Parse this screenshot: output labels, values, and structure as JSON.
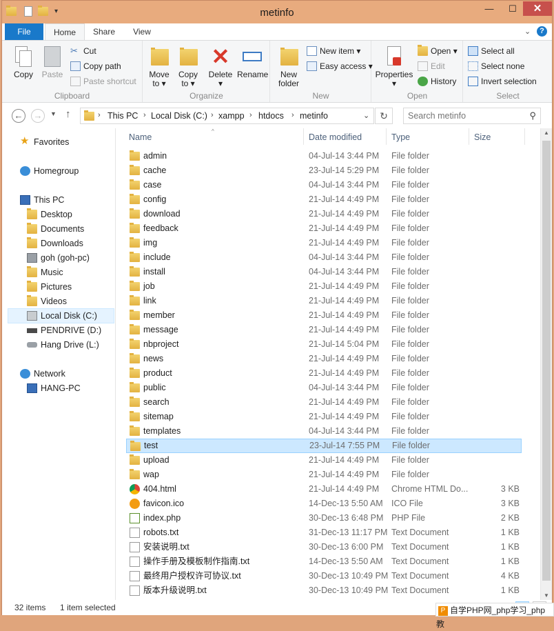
{
  "window": {
    "title": "metinfo",
    "minimize_icon": "minimize-icon",
    "maximize_icon": "maximize-icon",
    "close_label": "✕"
  },
  "tabs": [
    {
      "label": "File"
    },
    {
      "label": "Home"
    },
    {
      "label": "Share"
    },
    {
      "label": "View"
    }
  ],
  "ribbon": {
    "clipboard": {
      "label": "Clipboard",
      "copy": "Copy",
      "paste": "Paste",
      "cut": "Cut",
      "copy_path": "Copy path",
      "paste_shortcut": "Paste shortcut"
    },
    "organize": {
      "label": "Organize",
      "move_to": "Move to",
      "copy_to": "Copy to",
      "delete": "Delete",
      "rename": "Rename"
    },
    "new": {
      "label": "New",
      "new_folder": "New folder",
      "new_item": "New item",
      "easy_access": "Easy access"
    },
    "open": {
      "label": "Open",
      "properties": "Properties",
      "open": "Open",
      "edit": "Edit",
      "history": "History"
    },
    "select": {
      "label": "Select",
      "select_all": "Select all",
      "select_none": "Select none",
      "invert": "Invert selection"
    }
  },
  "address": {
    "crumbs": [
      "This PC",
      "Local Disk (C:)",
      "xampp",
      "htdocs",
      "metinfo"
    ],
    "search_placeholder": "Search metinfo"
  },
  "nav": {
    "favorites": "Favorites",
    "homegroup": "Homegroup",
    "this_pc": "This PC",
    "pc_items": [
      "Desktop",
      "Documents",
      "Downloads",
      "goh (goh-pc)",
      "Music",
      "Pictures",
      "Videos",
      "Local Disk (C:)",
      "PENDRIVE (D:)",
      "Hang Drive (L:)"
    ],
    "network": "Network",
    "network_items": [
      "HANG-PC"
    ]
  },
  "columns": {
    "name": "Name",
    "date": "Date modified",
    "type": "Type",
    "size": "Size"
  },
  "files": [
    {
      "name": "admin",
      "date": "04-Jul-14 3:44 PM",
      "type": "File folder",
      "size": "",
      "icon": "folder"
    },
    {
      "name": "cache",
      "date": "23-Jul-14 5:29 PM",
      "type": "File folder",
      "size": "",
      "icon": "folder"
    },
    {
      "name": "case",
      "date": "04-Jul-14 3:44 PM",
      "type": "File folder",
      "size": "",
      "icon": "folder"
    },
    {
      "name": "config",
      "date": "21-Jul-14 4:49 PM",
      "type": "File folder",
      "size": "",
      "icon": "folder"
    },
    {
      "name": "download",
      "date": "21-Jul-14 4:49 PM",
      "type": "File folder",
      "size": "",
      "icon": "folder"
    },
    {
      "name": "feedback",
      "date": "21-Jul-14 4:49 PM",
      "type": "File folder",
      "size": "",
      "icon": "folder"
    },
    {
      "name": "img",
      "date": "21-Jul-14 4:49 PM",
      "type": "File folder",
      "size": "",
      "icon": "folder"
    },
    {
      "name": "include",
      "date": "04-Jul-14 3:44 PM",
      "type": "File folder",
      "size": "",
      "icon": "folder"
    },
    {
      "name": "install",
      "date": "04-Jul-14 3:44 PM",
      "type": "File folder",
      "size": "",
      "icon": "folder"
    },
    {
      "name": "job",
      "date": "21-Jul-14 4:49 PM",
      "type": "File folder",
      "size": "",
      "icon": "folder"
    },
    {
      "name": "link",
      "date": "21-Jul-14 4:49 PM",
      "type": "File folder",
      "size": "",
      "icon": "folder"
    },
    {
      "name": "member",
      "date": "21-Jul-14 4:49 PM",
      "type": "File folder",
      "size": "",
      "icon": "folder"
    },
    {
      "name": "message",
      "date": "21-Jul-14 4:49 PM",
      "type": "File folder",
      "size": "",
      "icon": "folder"
    },
    {
      "name": "nbproject",
      "date": "21-Jul-14 5:04 PM",
      "type": "File folder",
      "size": "",
      "icon": "folder"
    },
    {
      "name": "news",
      "date": "21-Jul-14 4:49 PM",
      "type": "File folder",
      "size": "",
      "icon": "folder"
    },
    {
      "name": "product",
      "date": "21-Jul-14 4:49 PM",
      "type": "File folder",
      "size": "",
      "icon": "folder"
    },
    {
      "name": "public",
      "date": "04-Jul-14 3:44 PM",
      "type": "File folder",
      "size": "",
      "icon": "folder"
    },
    {
      "name": "search",
      "date": "21-Jul-14 4:49 PM",
      "type": "File folder",
      "size": "",
      "icon": "folder"
    },
    {
      "name": "sitemap",
      "date": "21-Jul-14 4:49 PM",
      "type": "File folder",
      "size": "",
      "icon": "folder"
    },
    {
      "name": "templates",
      "date": "04-Jul-14 3:44 PM",
      "type": "File folder",
      "size": "",
      "icon": "folder"
    },
    {
      "name": "test",
      "date": "23-Jul-14 7:55 PM",
      "type": "File folder",
      "size": "",
      "icon": "folder",
      "selected": true
    },
    {
      "name": "upload",
      "date": "21-Jul-14 4:49 PM",
      "type": "File folder",
      "size": "",
      "icon": "folder"
    },
    {
      "name": "wap",
      "date": "21-Jul-14 4:49 PM",
      "type": "File folder",
      "size": "",
      "icon": "folder"
    },
    {
      "name": "404.html",
      "date": "21-Jul-14 4:49 PM",
      "type": "Chrome HTML Do...",
      "size": "3 KB",
      "icon": "chrome"
    },
    {
      "name": "favicon.ico",
      "date": "14-Dec-13 5:50 AM",
      "type": "ICO File",
      "size": "3 KB",
      "icon": "ico"
    },
    {
      "name": "index.php",
      "date": "30-Dec-13 6:48 PM",
      "type": "PHP File",
      "size": "2 KB",
      "icon": "php"
    },
    {
      "name": "robots.txt",
      "date": "31-Dec-13 11:17 PM",
      "type": "Text Document",
      "size": "1 KB",
      "icon": "txt"
    },
    {
      "name": "安装说明.txt",
      "date": "30-Dec-13 6:00 PM",
      "type": "Text Document",
      "size": "1 KB",
      "icon": "txt"
    },
    {
      "name": "操作手册及模板制作指南.txt",
      "date": "14-Dec-13 5:50 AM",
      "type": "Text Document",
      "size": "1 KB",
      "icon": "txt"
    },
    {
      "name": "最终用户授权许可协议.txt",
      "date": "30-Dec-13 10:49 PM",
      "type": "Text Document",
      "size": "4 KB",
      "icon": "txt"
    },
    {
      "name": "版本升级说明.txt",
      "date": "30-Dec-13 10:49 PM",
      "type": "Text Document",
      "size": "1 KB",
      "icon": "txt"
    }
  ],
  "status": {
    "items": "32 items",
    "selected": "1 item selected"
  },
  "watermark": "自学PHP网_php学习_php教"
}
